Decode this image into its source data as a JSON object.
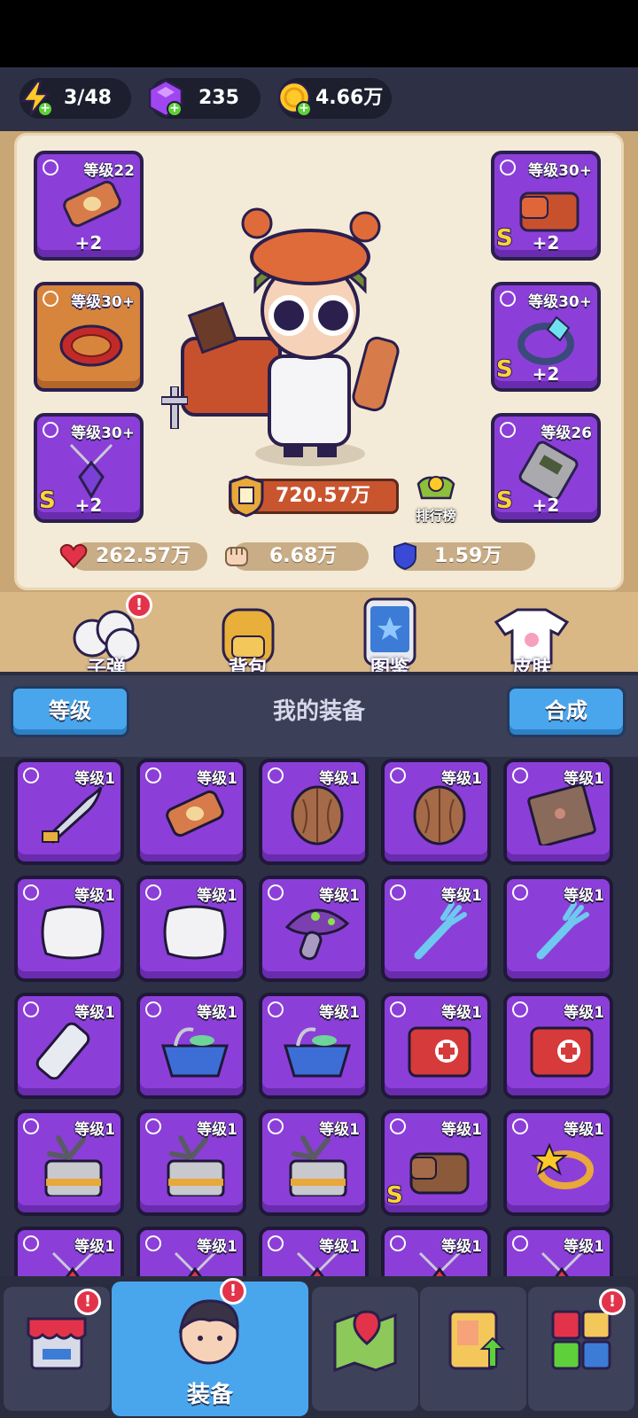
{
  "resources": {
    "energy": "3/48",
    "gems": "235",
    "coins": "4.66万"
  },
  "equipped": [
    {
      "level": "等级22",
      "plus": "+2",
      "frame": "purple",
      "s": false,
      "art": "scroll"
    },
    {
      "level": "等级30+",
      "plus": "+2",
      "frame": "purple",
      "s": true,
      "art": "backpack"
    },
    {
      "level": "等级30+",
      "plus": "",
      "frame": "orange",
      "s": false,
      "art": "ring-red"
    },
    {
      "level": "等级30+",
      "plus": "+2",
      "frame": "purple",
      "s": true,
      "art": "ring-blue"
    },
    {
      "level": "等级30+",
      "plus": "+2",
      "frame": "purple",
      "s": true,
      "art": "amulet"
    },
    {
      "level": "等级26",
      "plus": "+2",
      "frame": "purple",
      "s": true,
      "art": "device"
    }
  ],
  "power": "720.57万",
  "rank_label": "排行榜",
  "stats": {
    "hp": "262.57万",
    "attack": "6.68万",
    "defense": "1.59万"
  },
  "menu": {
    "bullets": "子弹",
    "backpack": "背包",
    "codex": "图鉴",
    "skins": "皮肤",
    "alert": "!"
  },
  "equipment_header": {
    "level_button": "等级",
    "title": "我的装备",
    "merge_button": "合成"
  },
  "inventory": [
    {
      "level": "等级1",
      "art": "dagger",
      "s": false
    },
    {
      "level": "等级1",
      "art": "scroll",
      "s": false
    },
    {
      "level": "等级1",
      "art": "walnut",
      "s": false
    },
    {
      "level": "等级1",
      "art": "walnut",
      "s": false
    },
    {
      "level": "等级1",
      "art": "book",
      "s": false
    },
    {
      "level": "等级1",
      "art": "pillow",
      "s": false
    },
    {
      "level": "等级1",
      "art": "pillow",
      "s": false
    },
    {
      "level": "等级1",
      "art": "mushroom",
      "s": false
    },
    {
      "level": "等级1",
      "art": "fork",
      "s": false
    },
    {
      "level": "等级1",
      "art": "fork",
      "s": false
    },
    {
      "level": "等级1",
      "art": "bandage",
      "s": false
    },
    {
      "level": "等级1",
      "art": "basket",
      "s": false
    },
    {
      "level": "等级1",
      "art": "basket",
      "s": false
    },
    {
      "level": "等级1",
      "art": "medkit",
      "s": false
    },
    {
      "level": "等级1",
      "art": "medkit",
      "s": false
    },
    {
      "level": "等级1",
      "art": "fanbox",
      "s": false
    },
    {
      "level": "等级1",
      "art": "fanbox",
      "s": false
    },
    {
      "level": "等级1",
      "art": "fanbox",
      "s": false
    },
    {
      "level": "等级1",
      "art": "bag",
      "s": true
    },
    {
      "level": "等级1",
      "art": "star-ring",
      "s": false
    },
    {
      "level": "等级1",
      "art": "amulet",
      "s": false
    },
    {
      "level": "等级1",
      "art": "amulet",
      "s": false
    },
    {
      "level": "等级1",
      "art": "amulet",
      "s": false
    },
    {
      "level": "等级1",
      "art": "amulet",
      "s": false
    },
    {
      "level": "等级1",
      "art": "amulet",
      "s": false
    }
  ],
  "bottom_nav": {
    "equipment_label": "装备",
    "alert": "!"
  },
  "colors": {
    "purple_frame": "#8b3fd8",
    "orange_frame": "#d7853c",
    "blue_accent": "#4aa6ec",
    "alert_red": "#e3334a"
  }
}
